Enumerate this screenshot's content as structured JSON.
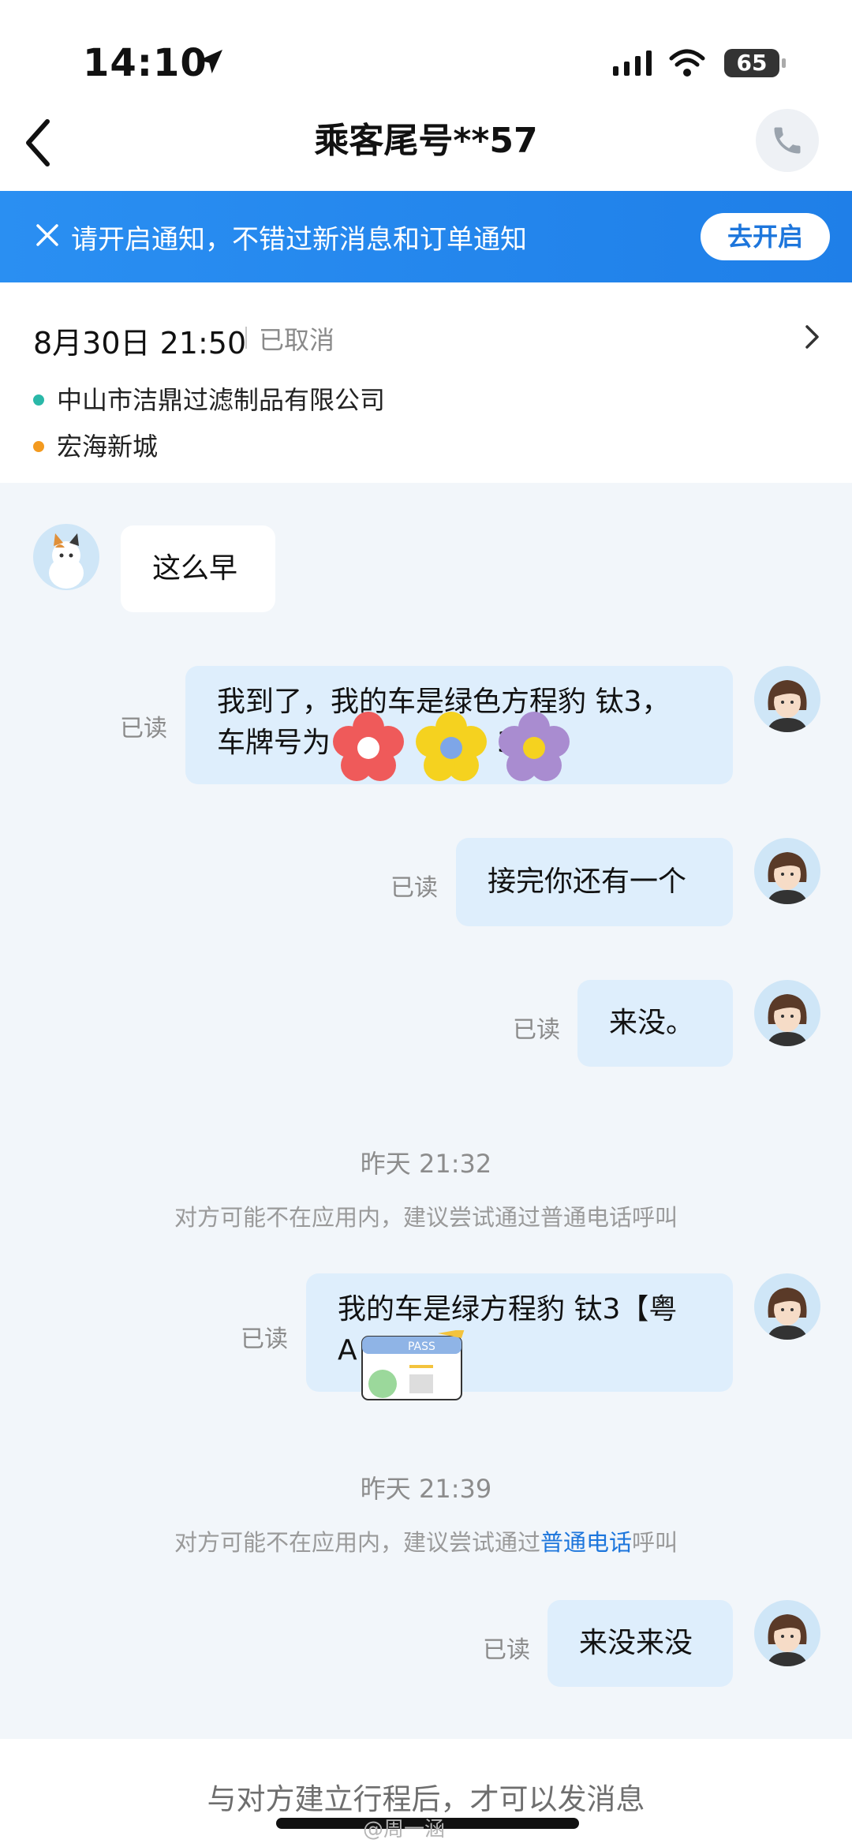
{
  "status": {
    "time": "14:10",
    "battery": "65"
  },
  "header": {
    "title": "乘客尾号**57"
  },
  "notice": {
    "text": "请开启通知，不错过新消息和订单通知",
    "button": "去开启"
  },
  "order": {
    "date": "8月30日 21:50",
    "status": "已取消",
    "from": "中山市洁鼎过滤制品有限公司",
    "to": "宏海新城",
    "colors": {
      "from_dot": "#2ab8a8",
      "to_dot": "#f39a1f"
    }
  },
  "messages": {
    "m1": "这么早",
    "m2_line1": "我到了，我的车是绿色方程豹 钛3，",
    "m2_line2": "车牌号为",
    "m2_tail": "A",
    "m2_tail2": "31",
    "m3": "接完你还有一个",
    "m4": "来没。",
    "m5_line1": "我的车是绿方程豹 钛3【粤",
    "m5_line2": "A",
    "m6": "来没来没",
    "read": "已读"
  },
  "sticker_text": "PASS",
  "system": {
    "ts1": "昨天 21:32",
    "hint1": "对方可能不在应用内，建议尝试通过普通电话呼叫",
    "ts2": "昨天 21:39",
    "hint2_pre": "对方可能不在应用内，建议尝试通过",
    "hint2_link": "普通电话",
    "hint2_post": "呼叫"
  },
  "footer": {
    "text": "与对方建立行程后，才可以发消息"
  },
  "watermark": "@周一涵",
  "colors": {
    "accent": "#1f7fe8",
    "out_bubble": "#deeefc",
    "background": "#f2f6fa"
  }
}
